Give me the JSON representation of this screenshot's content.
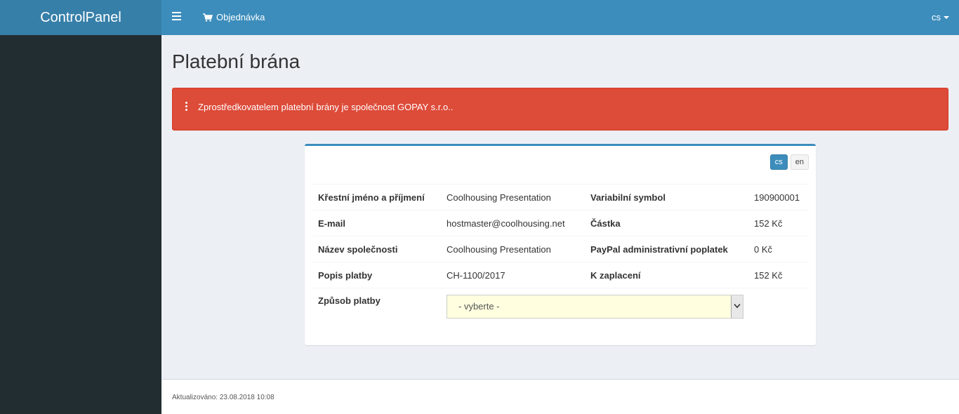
{
  "app": {
    "brand": "ControlPanel"
  },
  "header": {
    "order_label": "Objednávka",
    "language": "cs"
  },
  "page": {
    "title": "Platební brána"
  },
  "alert": {
    "text": "Zprostředkovatelem platební brány je společnost GOPAY s.r.o.."
  },
  "lang_buttons": [
    {
      "label": "cs",
      "active": true
    },
    {
      "label": "en",
      "active": false
    }
  ],
  "details": {
    "rows": [
      {
        "label1": "Křestní jméno a příjmení",
        "value1": "Coolhousing Presentation",
        "label2": "Variabilní symbol",
        "value2": "190900001"
      },
      {
        "label1": "E-mail",
        "value1": "hostmaster@coolhousing.net",
        "label2": "Částka",
        "value2": "152 Kč"
      },
      {
        "label1": "Název společnosti",
        "value1": "Coolhousing Presentation",
        "label2": "PayPal administrativní poplatek",
        "value2": "0 Kč"
      },
      {
        "label1": "Popis platby",
        "value1": "CH-1100/2017",
        "label2": "K zaplacení",
        "value2": "152 Kč"
      }
    ],
    "payment_method_label": "Způsob platby",
    "payment_method_value": "- vyberte -"
  },
  "footer": {
    "updated_text": "Aktualizováno: 23.08.2018 10:08"
  },
  "colors": {
    "navbar": "#3c8dbc",
    "logo_bg": "#367fa9",
    "sidebar": "#222d32",
    "alert_danger": "#dd4b39",
    "select_bg": "#ffffe0"
  }
}
